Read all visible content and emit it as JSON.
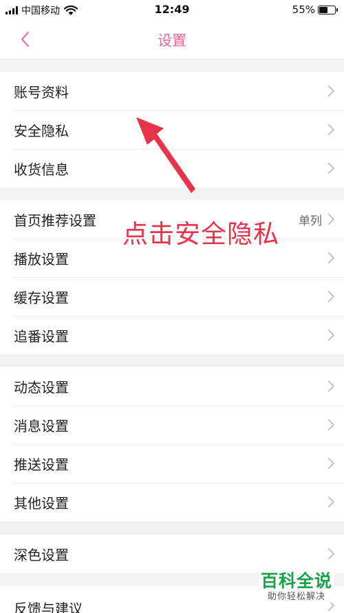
{
  "status_bar": {
    "carrier": "中国移动",
    "time": "12:49",
    "battery": "55%",
    "battery_level": 0.55
  },
  "nav": {
    "title": "设置",
    "back_icon": "chevron-left-icon"
  },
  "colors": {
    "accent": "#f06292",
    "annotation": "#e8344a",
    "watermark": "#1aa24a"
  },
  "groups": [
    {
      "items": [
        {
          "label": "账号资料"
        },
        {
          "label": "安全隐私"
        },
        {
          "label": "收货信息"
        }
      ]
    },
    {
      "items": [
        {
          "label": "首页推荐设置",
          "value": "单列"
        },
        {
          "label": "播放设置"
        },
        {
          "label": "缓存设置"
        },
        {
          "label": "追番设置"
        }
      ]
    },
    {
      "items": [
        {
          "label": "动态设置"
        },
        {
          "label": "消息设置"
        },
        {
          "label": "推送设置"
        },
        {
          "label": "其他设置"
        }
      ]
    },
    {
      "items": [
        {
          "label": "深色设置"
        }
      ]
    },
    {
      "items": [
        {
          "label": "反馈与建议"
        }
      ]
    }
  ],
  "annotation": {
    "text": "点击安全隐私",
    "icon": "arrow-pointer-icon"
  },
  "watermark": {
    "title": "百科全说",
    "subtitle": "助你轻松解决"
  }
}
